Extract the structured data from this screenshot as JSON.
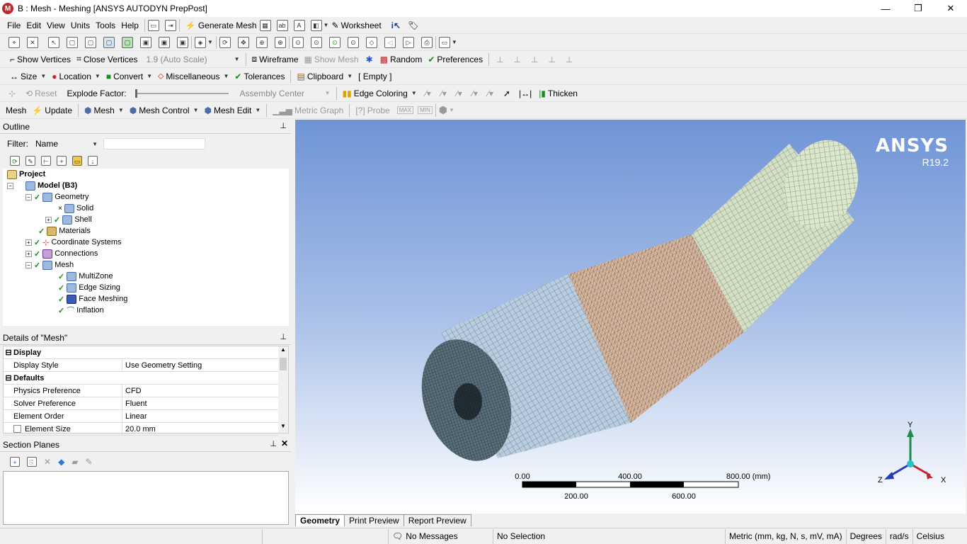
{
  "app": {
    "title": "B : Mesh - Meshing [ANSYS AUTODYN PrepPost]",
    "logo_letter": "M"
  },
  "window_controls": {
    "minimize": "—",
    "restore": "❐",
    "close": "✕"
  },
  "menu": {
    "items": [
      "File",
      "Edit",
      "View",
      "Units",
      "Tools",
      "Help"
    ],
    "generate_mesh": "Generate Mesh",
    "worksheet": "Worksheet"
  },
  "toolbar3": {
    "show_vertices": "Show Vertices",
    "close_vertices": "Close Vertices",
    "scale_value": "1.9 (Auto Scale)",
    "wireframe": "Wireframe",
    "show_mesh": "Show Mesh",
    "random": "Random",
    "preferences": "Preferences"
  },
  "toolbar4": {
    "size": "Size",
    "location": "Location",
    "convert": "Convert",
    "miscellaneous": "Miscellaneous",
    "tolerances": "Tolerances",
    "clipboard": "Clipboard",
    "clipboard_state": "[ Empty ]"
  },
  "toolbar5": {
    "reset": "Reset",
    "explode_factor": "Explode Factor:",
    "assembly_center": "Assembly Center",
    "edge_coloring": "Edge Coloring",
    "thicken": "Thicken"
  },
  "toolbar6": {
    "mesh": "Mesh",
    "update": "Update",
    "mesh_menu": "Mesh",
    "mesh_control": "Mesh Control",
    "mesh_edit": "Mesh Edit",
    "metric_graph": "Metric Graph",
    "probe": "Probe",
    "max": "MAX",
    "min": "MIN"
  },
  "outline": {
    "title": "Outline",
    "filter_label": "Filter:",
    "filter_value": "Name",
    "tree": [
      {
        "label": "Project",
        "bold": true
      },
      {
        "label": "Model (B3)",
        "bold": true
      },
      {
        "label": "Geometry"
      },
      {
        "label": "Solid"
      },
      {
        "label": "Shell"
      },
      {
        "label": "Materials"
      },
      {
        "label": "Coordinate Systems"
      },
      {
        "label": "Connections"
      },
      {
        "label": "Mesh"
      },
      {
        "label": "MultiZone"
      },
      {
        "label": "Edge Sizing"
      },
      {
        "label": "Face Meshing"
      },
      {
        "label": "Inflation"
      }
    ]
  },
  "details": {
    "title": "Details of \"Mesh\"",
    "rows": [
      {
        "key": "Display",
        "category": true
      },
      {
        "key": "Display Style",
        "value": "Use Geometry Setting"
      },
      {
        "key": "Defaults",
        "category": true
      },
      {
        "key": "Physics Preference",
        "value": "CFD"
      },
      {
        "key": "Solver Preference",
        "value": "Fluent"
      },
      {
        "key": "Element Order",
        "value": "Linear"
      },
      {
        "key": "Element Size",
        "value": "20.0 mm"
      }
    ]
  },
  "section_planes": {
    "title": "Section Planes"
  },
  "viewport": {
    "brand": "ANSYS",
    "version": "R19.2",
    "scale": {
      "labels_top": [
        "0.00",
        "400.00",
        "800.00 (mm)"
      ],
      "labels_bottom": [
        "200.00",
        "600.00"
      ]
    },
    "triad": {
      "x": "X",
      "y": "Y",
      "z": "Z"
    }
  },
  "tabs": [
    "Geometry",
    "Print Preview",
    "Report Preview"
  ],
  "status": {
    "messages": "No Messages",
    "selection": "No Selection",
    "units": "Metric (mm, kg, N, s, mV, mA)",
    "angle": "Degrees",
    "rate": "rad/s",
    "temp": "Celsius"
  },
  "colors": {
    "blue_section": "#b9cde0",
    "copper_section": "#d8b8a0",
    "green_section": "#d4e0c4",
    "mesh_line": "#33404a"
  }
}
